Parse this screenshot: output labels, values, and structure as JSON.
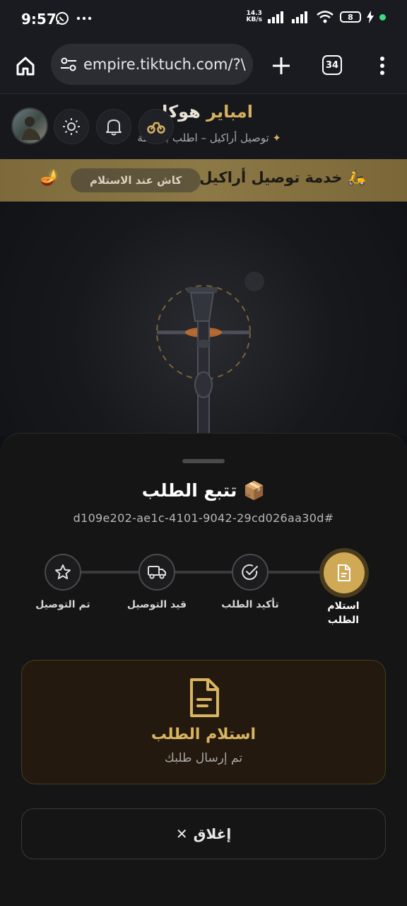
{
  "status_bar": {
    "time": "9:57",
    "net_speed_top": "14.3",
    "net_speed_bottom": "KB/s",
    "battery": "8",
    "accent_dot_color": "#3ddc84"
  },
  "browser": {
    "url": "empire.tiktuch.com/?\\",
    "tab_count": "34"
  },
  "site": {
    "brand_gold": "امباير",
    "brand_white": "هوكا",
    "tagline": "توصيل أراكيل – اطلب بضغطة",
    "tagline_star": "✦"
  },
  "banner": {
    "title": "خدمة توصيل أراكيل",
    "title_icon": "🛵",
    "pill": "كاش عند الاستلام",
    "lamp": "🪔"
  },
  "sheet": {
    "title": "تتبع الطلب",
    "title_icon": "📦",
    "order_id": "d109e202-ae1c-4101-9042-29cd026aa30d#",
    "steps": [
      {
        "label": "استلام الطلب",
        "icon": "document-icon",
        "active": true
      },
      {
        "label": "تأكيد الطلب",
        "icon": "check-circle-icon",
        "active": false
      },
      {
        "label": "قيد التوصيل",
        "icon": "truck-icon",
        "active": false
      },
      {
        "label": "تم التوصيل",
        "icon": "star-icon",
        "active": false
      }
    ],
    "status_card": {
      "heading": "استلام الطلب",
      "sub": "تم إرسال طلبك",
      "icon": "document-icon"
    },
    "close_label": "إغلاق",
    "close_icon": "✕"
  },
  "colors": {
    "accent_gold": "#cfa955",
    "banner_gold": "#8d7946",
    "background": "#101114"
  }
}
